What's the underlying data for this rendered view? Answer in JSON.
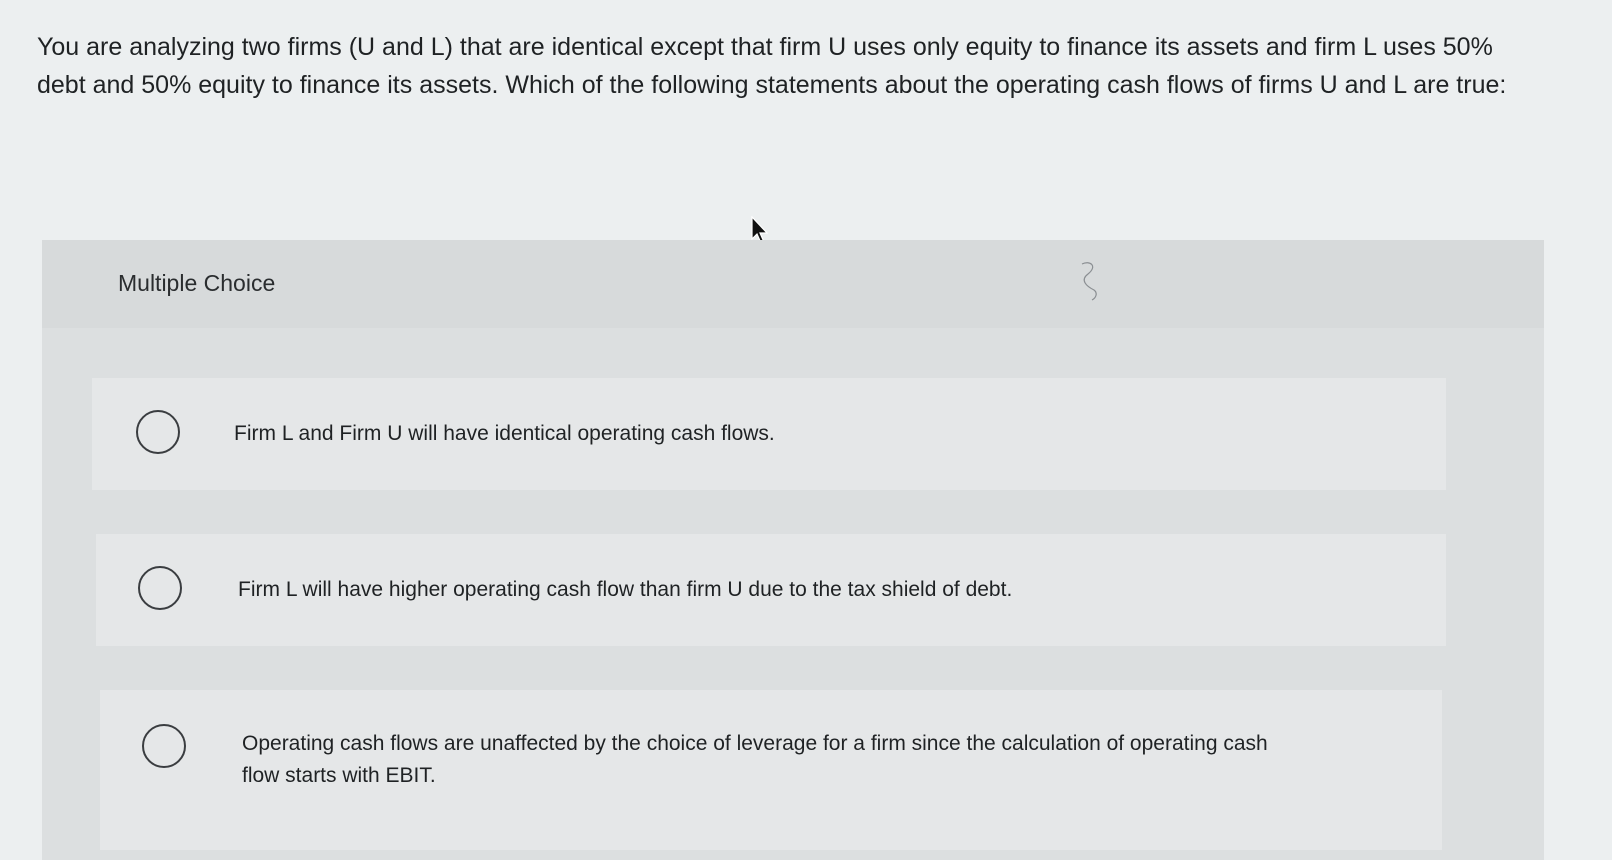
{
  "question": {
    "text": "You are analyzing two firms (U and L) that are identical except that firm U uses only equity to finance its assets and firm L uses 50% debt and 50% equity to finance its assets. Which of the following statements about the operating cash flows of firms U and L are true:"
  },
  "multiple_choice": {
    "title": "Multiple Choice",
    "options": [
      {
        "label": "Firm L and Firm U will have identical operating cash flows."
      },
      {
        "label": "Firm L will have higher operating cash flow than firm U due to the tax shield of debt."
      },
      {
        "label": "Operating cash flows are unaffected by the choice of leverage for a firm since the calculation of operating cash flow starts with EBIT."
      }
    ]
  },
  "icons": {
    "cursor": "mouse-pointer-icon",
    "radio": "radio-unselected-icon"
  },
  "colors": {
    "page_background": "#eceff0",
    "panel_background": "#dcdfe0",
    "option_background": "#e5e7e8",
    "text": "#1f2224"
  }
}
